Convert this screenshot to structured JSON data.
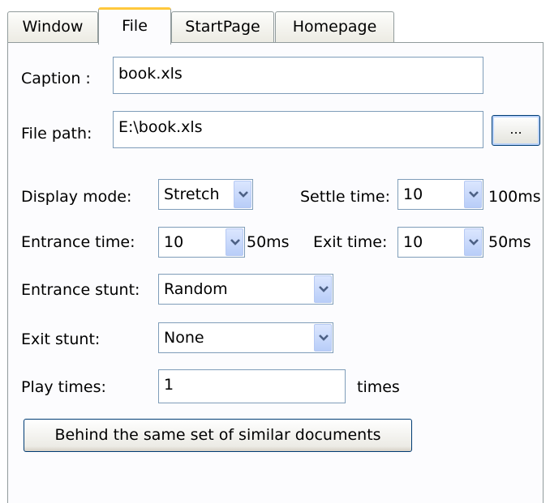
{
  "tabs": [
    {
      "label": "Window",
      "active": false
    },
    {
      "label": "File",
      "active": true
    },
    {
      "label": "StartPage",
      "active": false
    },
    {
      "label": "Homepage",
      "active": false
    }
  ],
  "form": {
    "caption_label": "Caption :",
    "caption_value": "book.xls",
    "filepath_label": "File path:",
    "filepath_value": "E:\\book.xls",
    "browse_label": "...",
    "display_mode_label": "Display mode:",
    "display_mode_value": "Stretch",
    "settle_time_label": "Settle time:",
    "settle_time_value": "10",
    "settle_time_unit": "100ms",
    "entrance_time_label": "Entrance time:",
    "entrance_time_value": "10",
    "entrance_time_unit": "50ms",
    "exit_time_label": "Exit time:",
    "exit_time_value": "10",
    "exit_time_unit": "50ms",
    "entrance_stunt_label": "Entrance stunt:",
    "entrance_stunt_value": "Random",
    "exit_stunt_label": "Exit stunt:",
    "exit_stunt_value": "None",
    "play_times_label": "Play times:",
    "play_times_value": "1",
    "play_times_unit": "times",
    "apply_similar_button": "Behind the same set of similar documents"
  },
  "colors": {
    "active_tab_accent": "#ffc83c",
    "field_border": "#7f9db9",
    "dropdown_button": "#c3d6fb"
  },
  "icons": [
    "chevron-down-icon"
  ]
}
